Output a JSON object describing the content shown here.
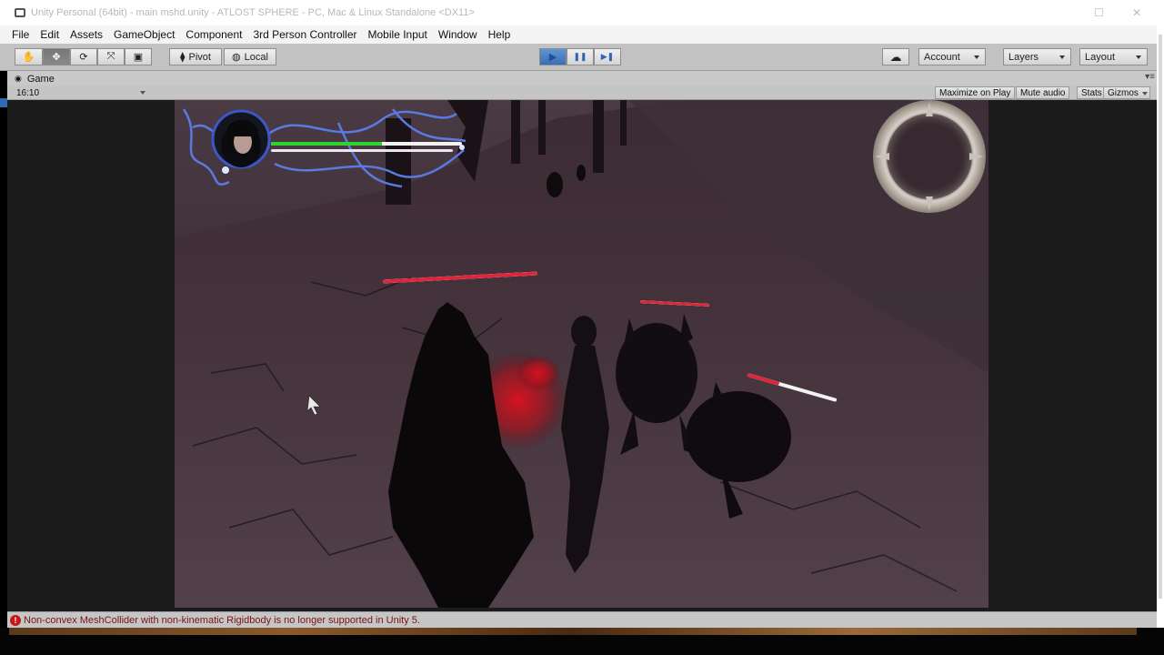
{
  "window": {
    "title": "Unity Personal (64bit) - main mshd.unity - ATLOST SPHERE - PC, Mac & Linux Standalone <DX11>",
    "minimize_glyph": "☐",
    "close_glyph": "✕"
  },
  "menubar": {
    "items": [
      "File",
      "Edit",
      "Assets",
      "GameObject",
      "Component",
      "3rd Person Controller",
      "Mobile Input",
      "Window",
      "Help"
    ]
  },
  "toolbar": {
    "tools": [
      {
        "icon": "hand-icon",
        "glyph": "✋"
      },
      {
        "icon": "move-icon",
        "glyph": "✥"
      },
      {
        "icon": "rotate-icon",
        "glyph": "⟳"
      },
      {
        "icon": "scale-icon",
        "glyph": "⤧"
      },
      {
        "icon": "rect-tool-icon",
        "glyph": "▣"
      }
    ],
    "active_tool": "move-icon",
    "pivot_label": "Pivot",
    "local_label": "Local",
    "play_glyph": "▶",
    "pause_glyph": "❚❚",
    "step_glyph": "▶❚",
    "cloud_glyph": "☁",
    "account_label": "Account",
    "layers_label": "Layers",
    "layout_label": "Layout",
    "play_active": true,
    "accent_color": "#3d78c4"
  },
  "game_panel": {
    "tab_label": "Game",
    "aspect_value": "16:10",
    "buttons": [
      "Maximize on Play",
      "Mute audio",
      "Stats",
      "Gizmos"
    ]
  },
  "hud": {
    "player_health_fraction": 0.58,
    "player_health_color": "#2fd32f",
    "enemy_health_color": "#e2243a",
    "enemy_health_fractions": [
      1.0,
      1.0,
      0.35
    ]
  },
  "console": {
    "message": "Non-convex MeshCollider with non-kinematic Rigidbody is no longer supported in Unity 5."
  }
}
